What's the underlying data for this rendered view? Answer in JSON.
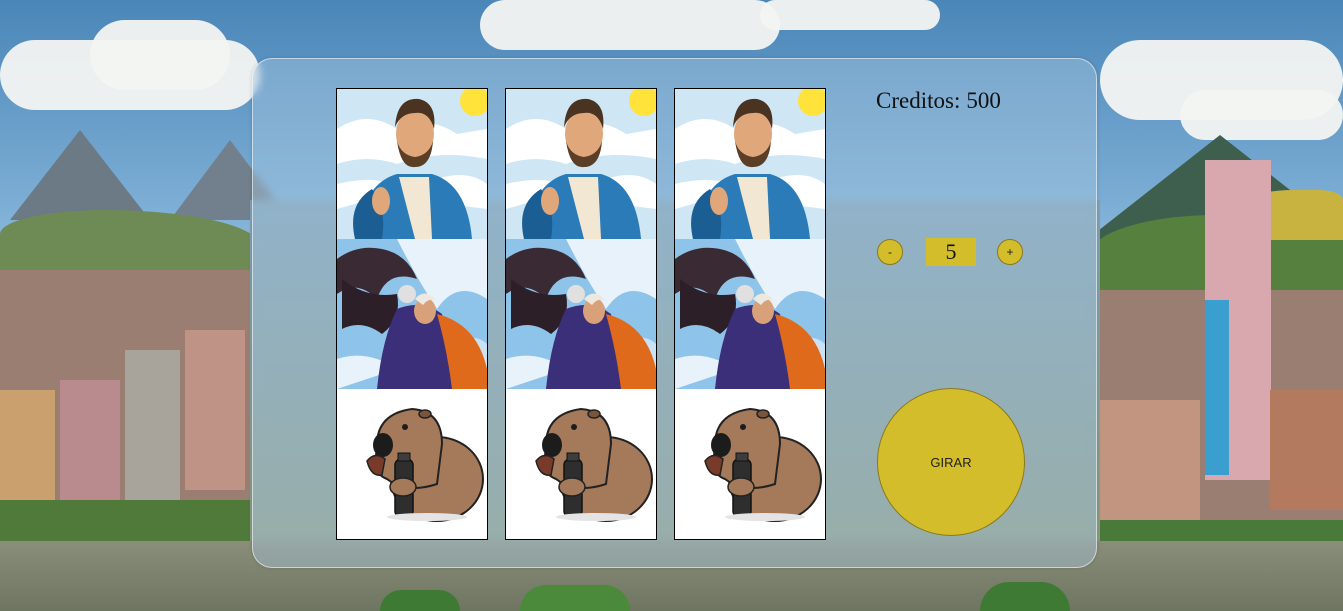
{
  "game": {
    "credits_label": "Creditos:",
    "credits_value": "500",
    "bet_value": "5",
    "decrease_label": "-",
    "increase_label": "+",
    "spin_label": "GIRAR"
  },
  "reels": [
    {
      "symbols": [
        "saint-portrait",
        "eagle-warrior",
        "capybara-mate"
      ]
    },
    {
      "symbols": [
        "saint-portrait",
        "eagle-warrior",
        "capybara-mate"
      ]
    },
    {
      "symbols": [
        "saint-portrait",
        "eagle-warrior",
        "capybara-mate"
      ]
    }
  ],
  "colors": {
    "accent": "#d4bd2a",
    "panel": "#aac8e1"
  }
}
